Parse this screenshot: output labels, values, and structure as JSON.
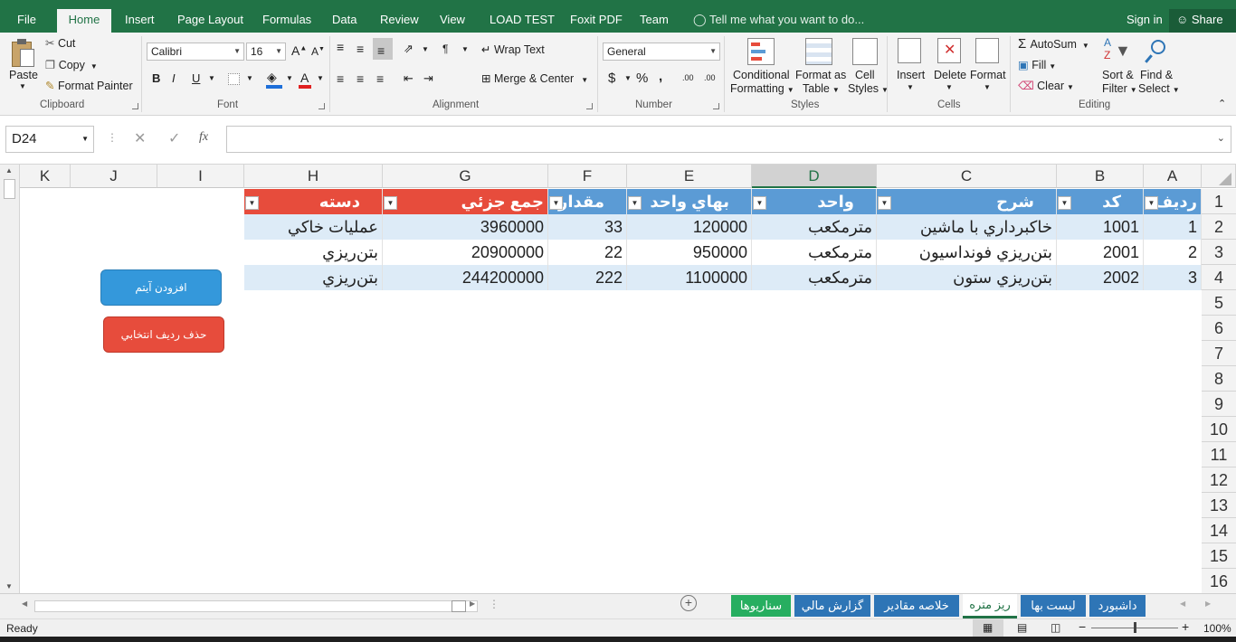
{
  "app": {
    "accent": "#217346"
  },
  "ribbon_tabs": [
    {
      "label": "File"
    },
    {
      "label": "Home",
      "active": true
    },
    {
      "label": "Insert"
    },
    {
      "label": "Page Layout"
    },
    {
      "label": "Formulas"
    },
    {
      "label": "Data"
    },
    {
      "label": "Review"
    },
    {
      "label": "View"
    },
    {
      "label": "LOAD TEST"
    },
    {
      "label": "Foxit PDF"
    },
    {
      "label": "Team"
    }
  ],
  "tell_me": "Tell me what you want to do...",
  "sign_in": "Sign in",
  "share": "Share",
  "clipboard": {
    "paste": "Paste",
    "cut": "Cut",
    "copy": "Copy",
    "format_painter": "Format Painter",
    "label": "Clipboard"
  },
  "font": {
    "name": "Calibri",
    "size": "16",
    "label": "Font",
    "bold": "B",
    "italic": "I",
    "underline": "U",
    "grow": "A",
    "shrink": "A",
    "color": "A"
  },
  "alignment": {
    "wrap_text": "Wrap Text",
    "merge_center": "Merge & Center",
    "label": "Alignment"
  },
  "number": {
    "format": "General",
    "currency": "$",
    "percent": "%",
    "comma": ",",
    "inc_decimal": ".00",
    "dec_decimal": ".00",
    "label": "Number"
  },
  "styles": {
    "conditional": "Conditional",
    "conditional2": "Formatting",
    "format_as": "Format as",
    "format_as2": "Table",
    "cell": "Cell",
    "cell2": "Styles",
    "label": "Styles"
  },
  "cells": {
    "insert": "Insert",
    "delete": "Delete",
    "format": "Format",
    "label": "Cells"
  },
  "editing": {
    "autosum": "AutoSum",
    "fill": "Fill",
    "clear": "Clear",
    "sort": "Sort &",
    "sort2": "Filter",
    "find": "Find &",
    "find2": "Select",
    "label": "Editing"
  },
  "formula_bar": {
    "name_box": "D24",
    "fx": "fx",
    "value": ""
  },
  "columns": [
    "K",
    "J",
    "I",
    "H",
    "G",
    "F",
    "E",
    "D",
    "C",
    "B",
    "A"
  ],
  "selected_column": "D",
  "rows": [
    "1",
    "2",
    "3",
    "4",
    "5",
    "6",
    "7",
    "8",
    "9",
    "10",
    "11",
    "12",
    "13",
    "14",
    "15",
    "16"
  ],
  "table": {
    "headers": {
      "A": "رديف",
      "B": "كد",
      "C": "شرح",
      "D": "واحد",
      "E": "بهاي واحد",
      "F": "مقدار",
      "G": "جمع جزئي",
      "H": "دسته"
    },
    "records": [
      {
        "A": "1",
        "B": "1001",
        "C": "خاكبرداري با ماشين",
        "D": "مترمكعب",
        "E": "120000",
        "F": "33",
        "G": "3960000",
        "H": "عمليات خاكي"
      },
      {
        "A": "2",
        "B": "2001",
        "C": "بتن‌ريزي فونداسيون",
        "D": "مترمكعب",
        "E": "950000",
        "F": "22",
        "G": "20900000",
        "H": "بتن‌ريزي"
      },
      {
        "A": "3",
        "B": "2002",
        "C": "بتن‌ريزي ستون",
        "D": "مترمكعب",
        "E": "1100000",
        "F": "222",
        "G": "244200000",
        "H": "بتن‌ريزي"
      }
    ],
    "header_color_blue": "#5b9bd5",
    "header_color_red": "#e74c3c"
  },
  "buttons": {
    "add_item": "افزودن آيتم",
    "delete_row": "حذف رديف انتخابي"
  },
  "sheet_tabs": [
    {
      "label": "داشبورد",
      "color": "#2e75b6"
    },
    {
      "label": "ليست بها",
      "color": "#2e75b6"
    },
    {
      "label": "ريز متره",
      "color": "#e7e6e6",
      "active": true
    },
    {
      "label": "خلاصه مقادير",
      "color": "#2e75b6"
    },
    {
      "label": "گزارش مالي",
      "color": "#2e75b6"
    },
    {
      "label": "سناريوها",
      "color": "#27ae60"
    }
  ],
  "status": {
    "ready": "Ready",
    "zoom": "100%",
    "zoom_level": 1.0
  }
}
